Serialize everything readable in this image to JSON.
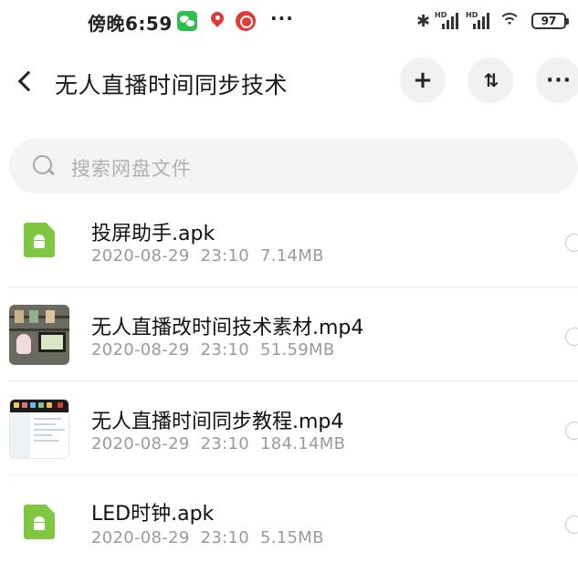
{
  "status_bar": {
    "time": "傍晚6:59",
    "more_indicator": "···",
    "bluetooth_icon": "bluetooth-icon",
    "network_label_1": "HD",
    "network_label_2": "HD",
    "battery_level": "97"
  },
  "header": {
    "title": "无人直播时间同步技术",
    "add_label": "+",
    "sort_label": "⇅",
    "more_label": "···"
  },
  "search": {
    "placeholder": "搜索网盘文件"
  },
  "files": [
    {
      "name": "投屏助手.apk",
      "date": "2020-08-29",
      "time": "23:10",
      "size": "7.14MB",
      "type": "apk"
    },
    {
      "name": "无人直播改时间技术素材.mp4",
      "date": "2020-08-29",
      "time": "23:10",
      "size": "51.59MB",
      "type": "video"
    },
    {
      "name": "无人直播时间同步教程.mp4",
      "date": "2020-08-29",
      "time": "23:10",
      "size": "184.14MB",
      "type": "video"
    },
    {
      "name": "LED时钟.apk",
      "date": "2020-08-29",
      "time": "23:10",
      "size": "5.15MB",
      "type": "apk"
    }
  ],
  "colors": {
    "apk_green": "#7fc741",
    "meta_gray": "#9a9a9a",
    "button_bg": "#f1f1f1",
    "search_bg": "#f4f4f4"
  }
}
